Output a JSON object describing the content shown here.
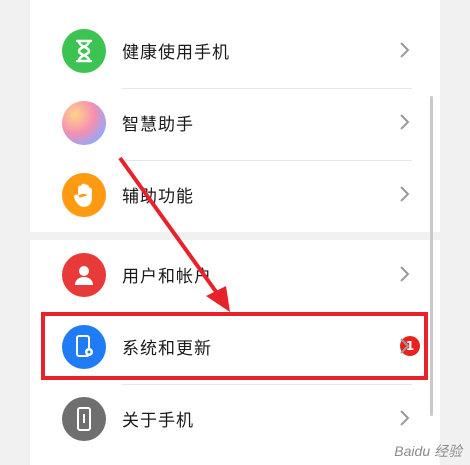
{
  "settings": {
    "items": [
      {
        "label": "健康使用手机",
        "icon": "hourglass-icon",
        "color": "#3cc352"
      },
      {
        "label": "智慧助手",
        "icon": "assistant-orb-icon",
        "color": "#e58fd0"
      },
      {
        "label": "辅助功能",
        "icon": "hand-icon",
        "color": "#ff9a12"
      },
      {
        "label": "用户和帐户",
        "icon": "user-icon",
        "color": "#e93a3a"
      },
      {
        "label": "系统和更新",
        "icon": "phone-settings-icon",
        "color": "#1f7cf5",
        "badge": "1"
      },
      {
        "label": "关于手机",
        "icon": "phone-info-icon",
        "color": "#6f6f6f"
      }
    ]
  },
  "annotation": {
    "highlight_color": "#e8222a"
  },
  "watermark": {
    "text": "Baidu 经验"
  }
}
